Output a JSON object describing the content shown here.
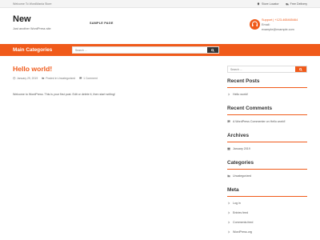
{
  "topbar": {
    "welcome": "Welcome To WordMania Store",
    "store_locator": "Store Locator",
    "free_delivery": "Free Delivery"
  },
  "header": {
    "site_title": "New",
    "tagline": "Just another WordPress site",
    "menu_item": "SAMPLE PAGE",
    "support_label": "Support | +123-465465464",
    "email_label": "Email:",
    "email_value": "example@example.com"
  },
  "nav": {
    "title": "Main Categories",
    "search_placeholder": "Search ..."
  },
  "post": {
    "title": "Hello world!",
    "date": "January 29, 2019",
    "category": "Posted in Uncategorized",
    "comments": "1 Comment",
    "body": "Welcome to WordPress. This is your first post. Edit or delete it, then start writing!"
  },
  "sidebar": {
    "search_placeholder": "Search ...",
    "recent_posts": {
      "title": "Recent Posts",
      "items": [
        "Hello world!"
      ]
    },
    "recent_comments": {
      "title": "Recent Comments",
      "items": [
        "A WordPress Commenter on Hello world!"
      ]
    },
    "archives": {
      "title": "Archives",
      "items": [
        "January 2019"
      ]
    },
    "categories": {
      "title": "Categories",
      "items": [
        "Uncategorized"
      ]
    },
    "meta": {
      "title": "Meta",
      "items": [
        "Log in",
        "Entries feed",
        "Comments feed",
        "WordPress.org"
      ]
    }
  },
  "colors": {
    "accent": "#f05a1a",
    "dark": "#333333"
  }
}
